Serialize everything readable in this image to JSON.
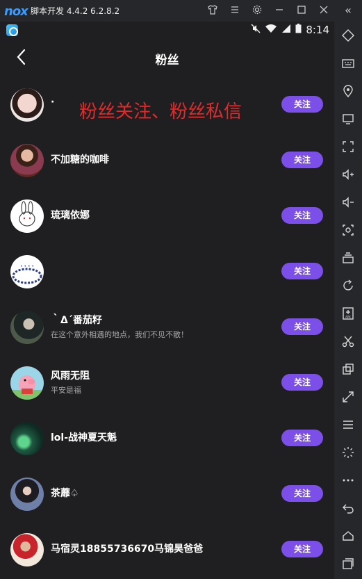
{
  "window": {
    "logo": "nox",
    "title": "脚本开发 4.4.2 6.2.8.2",
    "controls": [
      "shirt-icon",
      "menu-icon",
      "gear-icon",
      "minimize-icon",
      "maximize-icon",
      "close-icon"
    ],
    "collapse_icon": "«"
  },
  "statusbar": {
    "time": "8:14"
  },
  "appbar": {
    "title": "粉丝"
  },
  "overlay_text": "粉丝关注、粉丝私信",
  "follow_label": "关注",
  "fans": [
    {
      "name": "·",
      "sub": ""
    },
    {
      "name": "不加糖的咖啡",
      "sub": ""
    },
    {
      "name": "琉璃依娜",
      "sub": ""
    },
    {
      "name": "",
      "sub": ""
    },
    {
      "name": "｀Δ´番茄籽",
      "sub": "在这个意外相遇的地点，我们不见不散！"
    },
    {
      "name": "风雨无阻",
      "sub": "平安是福"
    },
    {
      "name": "lol-战神夏天魁",
      "sub": ""
    },
    {
      "name": "茶蘼♤",
      "sub": ""
    },
    {
      "name": "马宿灵18855736670马锦昊爸爸",
      "sub": ""
    }
  ],
  "colors": {
    "accent": "#7b4fe8",
    "background": "#1f1f21",
    "overlay": "#e22a2a"
  }
}
